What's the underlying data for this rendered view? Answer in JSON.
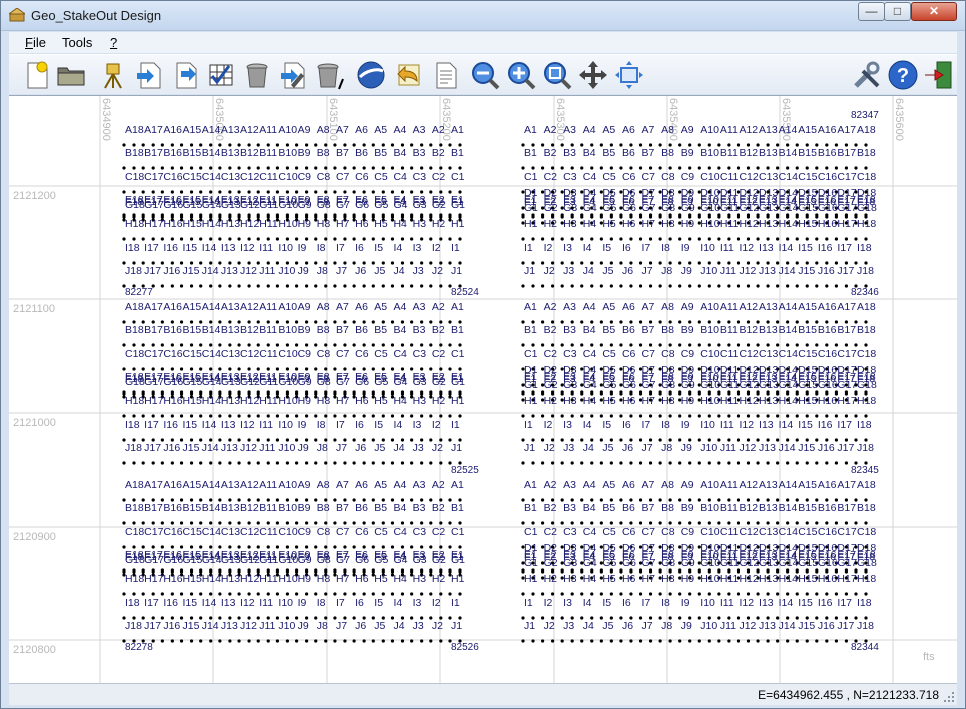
{
  "window": {
    "title": "Geo_StakeOut Design",
    "controls": {
      "minimize": "—",
      "maximize": "□",
      "close": "✕"
    }
  },
  "menu": [
    {
      "label": "File",
      "mnemonic": "F",
      "rest": "ile"
    },
    {
      "label": "Tools",
      "mnemonic": "",
      "rest": "Tools"
    },
    {
      "label": "?",
      "mnemonic": "?",
      "rest": ""
    }
  ],
  "toolbar": [
    {
      "name": "new-project-icon",
      "tip": "new"
    },
    {
      "name": "open-folder-icon",
      "tip": "open"
    },
    {
      "name": "survey-instrument-icon",
      "tip": "instrument"
    },
    {
      "name": "import-document-icon",
      "tip": "import"
    },
    {
      "name": "export-document-icon",
      "tip": "export"
    },
    {
      "name": "checklist-grid-icon",
      "tip": "grid"
    },
    {
      "name": "trash-bin-icon",
      "tip": "delete"
    },
    {
      "name": "edit-document-icon",
      "tip": "edit"
    },
    {
      "name": "trash-bin-slash-icon",
      "tip": "delete all"
    },
    {
      "name": "google-earth-icon",
      "tip": "earth"
    },
    {
      "name": "undo-document-icon",
      "tip": "undo"
    },
    {
      "name": "report-document-icon",
      "tip": "report"
    },
    {
      "name": "zoom-out-icon",
      "tip": "zoom out"
    },
    {
      "name": "zoom-in-icon",
      "tip": "zoom in"
    },
    {
      "name": "zoom-extents-icon",
      "tip": "zoom extents"
    },
    {
      "name": "pan-move-icon",
      "tip": "pan"
    },
    {
      "name": "zoom-window-icon",
      "tip": "zoom window"
    },
    {
      "name": "settings-tools-icon",
      "tip": "settings"
    },
    {
      "name": "help-icon",
      "tip": "help"
    },
    {
      "name": "exit-icon",
      "tip": "exit"
    }
  ],
  "plot": {
    "easting_labels": [
      "6434900",
      "6435000",
      "6435100",
      "6435200",
      "6435300",
      "6435400",
      "6435500",
      "6435600"
    ],
    "northing_labels": [
      "2121200",
      "2121100",
      "2121000",
      "2120900",
      "2120800"
    ],
    "units": "fts",
    "left_rows": [
      "A",
      "B",
      "C",
      "E",
      "F",
      "G",
      "H",
      "I",
      "J"
    ],
    "right_rows": [
      "A",
      "B",
      "C",
      "D",
      "E",
      "F",
      "G",
      "H",
      "I",
      "J"
    ],
    "corner_ids": {
      "b1_tl": "82347",
      "b1_bl": "82277",
      "b1_bm": "82524",
      "b1_br": "82346",
      "b2_bm": "82525",
      "b2_br": "82345",
      "b3_bl": "82278",
      "b3_bm": "82526",
      "b3_br": "82344"
    }
  },
  "status": {
    "coords": "E=6434962.455 , N=2121233.718"
  }
}
